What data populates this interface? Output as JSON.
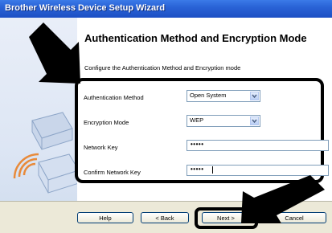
{
  "window": {
    "title": "Brother Wireless Device Setup Wizard"
  },
  "page": {
    "heading": "Authentication Method and Encryption Mode",
    "subtext": "Configure the Authentication Method and Encryption mode"
  },
  "form": {
    "auth_label": "Authentication Method",
    "auth_value": "Open System",
    "enc_label": "Encryption Mode",
    "enc_value": "WEP",
    "key_label": "Network Key",
    "key_value": "•••••",
    "confirm_label": "Confirm Network Key",
    "confirm_value": "•••••"
  },
  "buttons": {
    "help": "Help",
    "back": "< Back",
    "next": "Next >",
    "cancel": "Cancel"
  },
  "colors": {
    "accent": "#2a63d6",
    "highlight": "#000000"
  },
  "icons": [
    "arrow-icon",
    "printer-illustration-icon",
    "wireless-waves-icon",
    "dropdown-arrow-icon"
  ]
}
